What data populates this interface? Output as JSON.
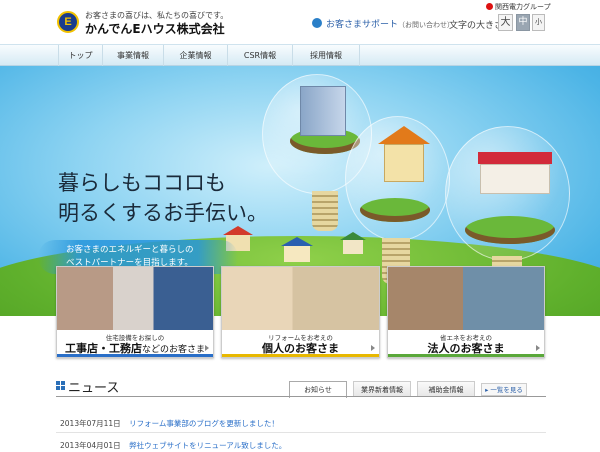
{
  "header": {
    "tagline": "お客さまの喜びは、私たちの喜びです。",
    "company_name": "かんでんEハウス株式会社",
    "logo_letter": "E",
    "group_badge": "関西電力グループ",
    "support_label": "お客さまサポート",
    "support_sub": "（お問い合わせ）",
    "font_size_label": "文字の大きさ",
    "font_sizes": [
      "大",
      "中",
      "小"
    ]
  },
  "nav": {
    "items": [
      "トップ",
      "事業情報",
      "企業情報",
      "CSR情報",
      "採用情報"
    ]
  },
  "hero": {
    "heading_line1": "暮らしもココロも",
    "heading_line2": "明るくするお手伝い。",
    "sub_line1": "お客さまのエネルギーと暮らしの",
    "sub_line2": "ベストパートナーを目指します。"
  },
  "cards": [
    {
      "small": "住宅設備をお探しの",
      "big": "工事店・工務店",
      "suffix": "などのお客さま",
      "accent": "#2a6fc8"
    },
    {
      "small": "リフォームをお考えの",
      "big": "個人のお客さま",
      "suffix": "",
      "accent": "#e8b800"
    },
    {
      "small": "省エネをお考えの",
      "big": "法人のお客さま",
      "suffix": "",
      "accent": "#5aa83a"
    }
  ],
  "news": {
    "title": "ニュース",
    "tabs": [
      "お知らせ",
      "業界新着情報",
      "補助金情報"
    ],
    "view_all": "一覧を見る",
    "items": [
      {
        "date": "2013年07月11日",
        "text": "リフォーム事業部のブログを更新しました！"
      },
      {
        "date": "2013年04月01日",
        "text": "弊社ウェブサイトをリニューアル致しました。"
      }
    ]
  },
  "colors": {
    "brand_blue": "#1a3c8c",
    "brand_yellow": "#f2c200",
    "link": "#2a6fc8",
    "sky": "#4cb4e6"
  }
}
